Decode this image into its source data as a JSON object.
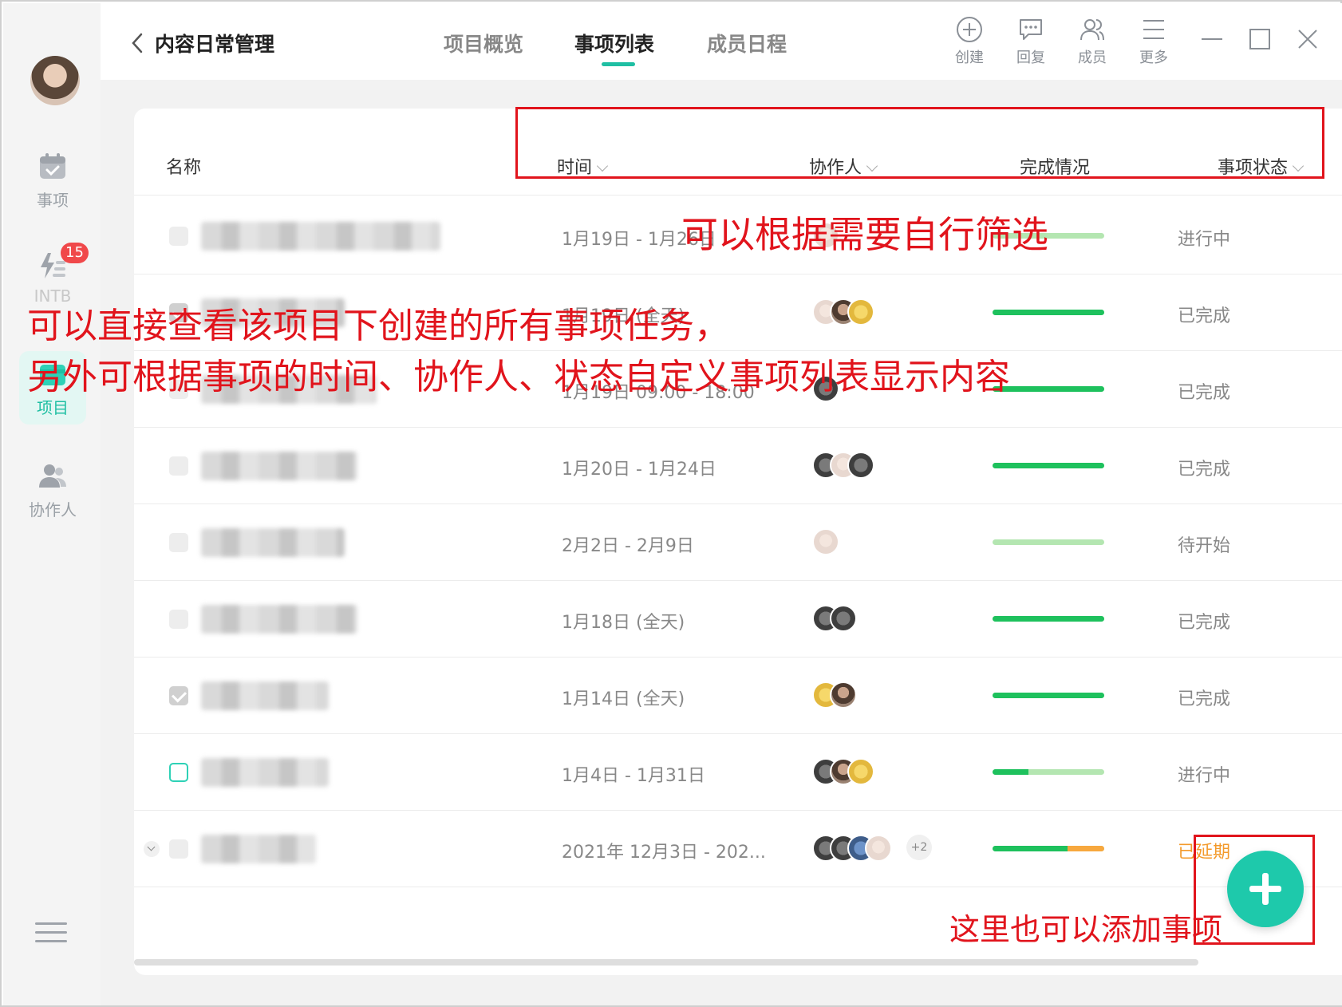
{
  "sidebar": {
    "items": [
      {
        "label": "事项"
      },
      {
        "label": "INTB"
      },
      {
        "label": "项目"
      },
      {
        "label": "协作人"
      }
    ],
    "badge": "15"
  },
  "header": {
    "title": "内容日常管理",
    "tabs": [
      {
        "label": "项目概览"
      },
      {
        "label": "事项列表"
      },
      {
        "label": "成员日程"
      }
    ],
    "tools": [
      {
        "label": "创建",
        "icon": "plus-circle-icon"
      },
      {
        "label": "回复",
        "icon": "comment-icon"
      },
      {
        "label": "成员",
        "icon": "members-icon"
      },
      {
        "label": "更多",
        "icon": "menu-icon"
      }
    ]
  },
  "table": {
    "columns": [
      "名称",
      "时间",
      "协作人",
      "完成情况",
      "事项状态"
    ],
    "rows": [
      {
        "time": "1月19日 - 1月26日",
        "status": "进行中",
        "progress": 0,
        "checked": false
      },
      {
        "time": "1月19日 (全天)",
        "status": "已完成",
        "progress": 1,
        "checked": true
      },
      {
        "time": "1月19日 09:00 - 18:00",
        "status": "已完成",
        "progress": 1,
        "checked": false
      },
      {
        "time": "1月20日 - 1月24日",
        "status": "已完成",
        "progress": 1,
        "checked": false
      },
      {
        "time": "2月2日 - 2月9日",
        "status": "待开始",
        "progress": 0,
        "checked": false
      },
      {
        "time": "1月18日 (全天)",
        "status": "已完成",
        "progress": 1,
        "checked": false
      },
      {
        "time": "1月14日 (全天)",
        "status": "已完成",
        "progress": 1,
        "checked": true
      },
      {
        "time": "1月4日 - 1月31日",
        "status": "进行中",
        "progress": 0.32,
        "checked": false
      },
      {
        "time": "2021年 12月3日 - 202...",
        "status": "已延期",
        "progress": 0.67,
        "overdue": 0.33,
        "checked": false,
        "extra_members": "+2"
      }
    ]
  },
  "annotations": {
    "filter_note": "可以根据需要自行筛选",
    "list_note_line1": "可以直接查看该项目下创建的所有事项任务，",
    "list_note_line2": "另外可根据事项的时间、协作人、状态自定义事项列表显示内容",
    "add_note": "这里也可以添加事项"
  },
  "colors": {
    "accent": "#1fbfa3",
    "done_bar": "#1ec15d",
    "pending_bar": "#b4e6b1",
    "overdue": "#f39a2b",
    "annotation": "#e1141c"
  }
}
